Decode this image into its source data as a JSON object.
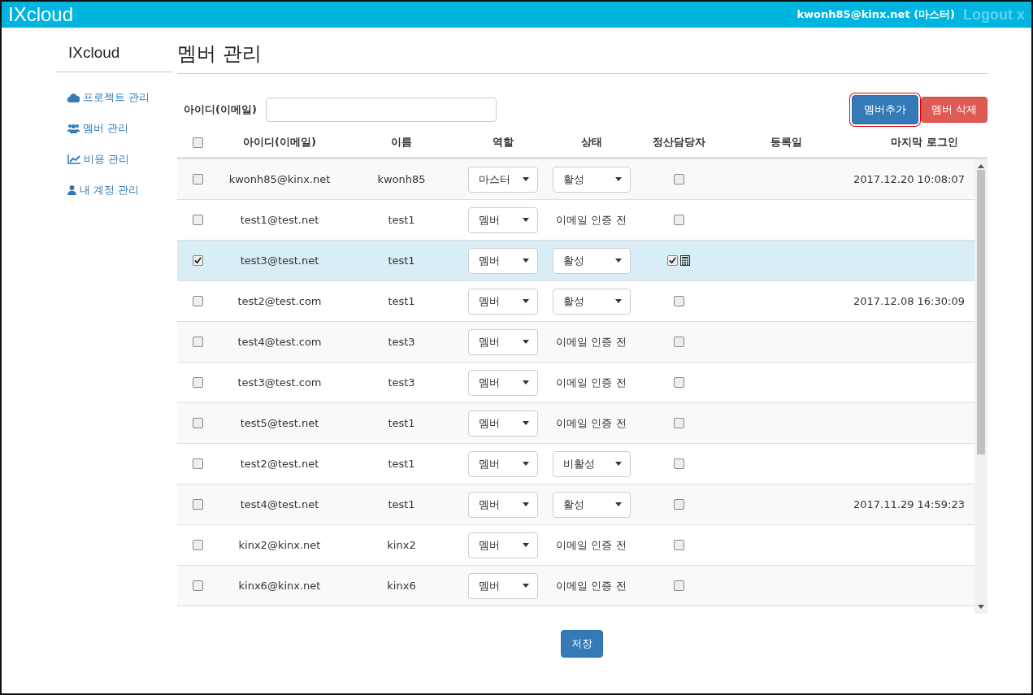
{
  "header": {
    "brand": "IXcloud",
    "user": "kwonh85@kinx.net (마스터)",
    "logout": "Logout x"
  },
  "sidebar": {
    "title": "IXcloud",
    "items": [
      {
        "label": "프로젝트 관리",
        "kind": "cloud"
      },
      {
        "label": "멤버 관리",
        "kind": "users"
      },
      {
        "label": "비용 관리",
        "kind": "chart"
      },
      {
        "label": "내 계정 관리",
        "kind": "user"
      }
    ]
  },
  "page_title": "멤버 관리",
  "search": {
    "label": "아이디(이메일)"
  },
  "buttons": [
    {
      "label": "멤버추가",
      "kind": "primary",
      "focused": true
    },
    {
      "label": "멤버 삭제",
      "kind": "danger",
      "focused": false
    }
  ],
  "table": {
    "select_all": false,
    "columns": [
      "아이디(이메일)",
      "이름",
      "역할",
      "상태",
      "정산담당자",
      "등록일",
      "마지막 로그인"
    ],
    "rows": [
      {
        "selected": false,
        "email": "kwonh85@kinx.net",
        "name": "kwonh85",
        "role": "마스터",
        "status": {
          "kind": "select",
          "value": "활성"
        },
        "billing": false,
        "last_login": "2017.12.20 10:08:07"
      },
      {
        "selected": false,
        "email": "test1@test.net",
        "name": "test1",
        "role": "멤버",
        "status": {
          "kind": "text",
          "value": "이메일 인증 전"
        },
        "billing": false
      },
      {
        "selected": true,
        "email": "test3@test.net",
        "name": "test1",
        "role": "멤버",
        "status": {
          "kind": "select",
          "value": "활성"
        },
        "billing": true
      },
      {
        "selected": false,
        "email": "test2@test.com",
        "name": "test1",
        "role": "멤버",
        "status": {
          "kind": "select",
          "value": "활성"
        },
        "billing": false,
        "last_login": "2017.12.08 16:30:09"
      },
      {
        "selected": false,
        "email": "test4@test.com",
        "name": "test3",
        "role": "멤버",
        "status": {
          "kind": "text",
          "value": "이메일 인증 전"
        },
        "billing": false
      },
      {
        "selected": false,
        "email": "test3@test.com",
        "name": "test3",
        "role": "멤버",
        "status": {
          "kind": "text",
          "value": "이메일 인증 전"
        },
        "billing": false
      },
      {
        "selected": false,
        "email": "test5@test.net",
        "name": "test1",
        "role": "멤버",
        "status": {
          "kind": "text",
          "value": "이메일 인증 전"
        },
        "billing": false
      },
      {
        "selected": false,
        "email": "test2@test.net",
        "name": "test1",
        "role": "멤버",
        "status": {
          "kind": "select",
          "value": "비활성"
        },
        "billing": false
      },
      {
        "selected": false,
        "email": "test4@test.net",
        "name": "test1",
        "role": "멤버",
        "status": {
          "kind": "select",
          "value": "활성"
        },
        "billing": false,
        "last_login": "2017.11.29 14:59:23"
      },
      {
        "selected": false,
        "email": "kinx2@kinx.net",
        "name": "kinx2",
        "role": "멤버",
        "status": {
          "kind": "text",
          "value": "이메일 인증 전"
        },
        "billing": false
      },
      {
        "selected": false,
        "email": "kinx6@kinx.net",
        "name": "kinx6",
        "role": "멤버",
        "status": {
          "kind": "text",
          "value": "이메일 인증 전"
        },
        "billing": false
      }
    ]
  },
  "save_button": "저장"
}
